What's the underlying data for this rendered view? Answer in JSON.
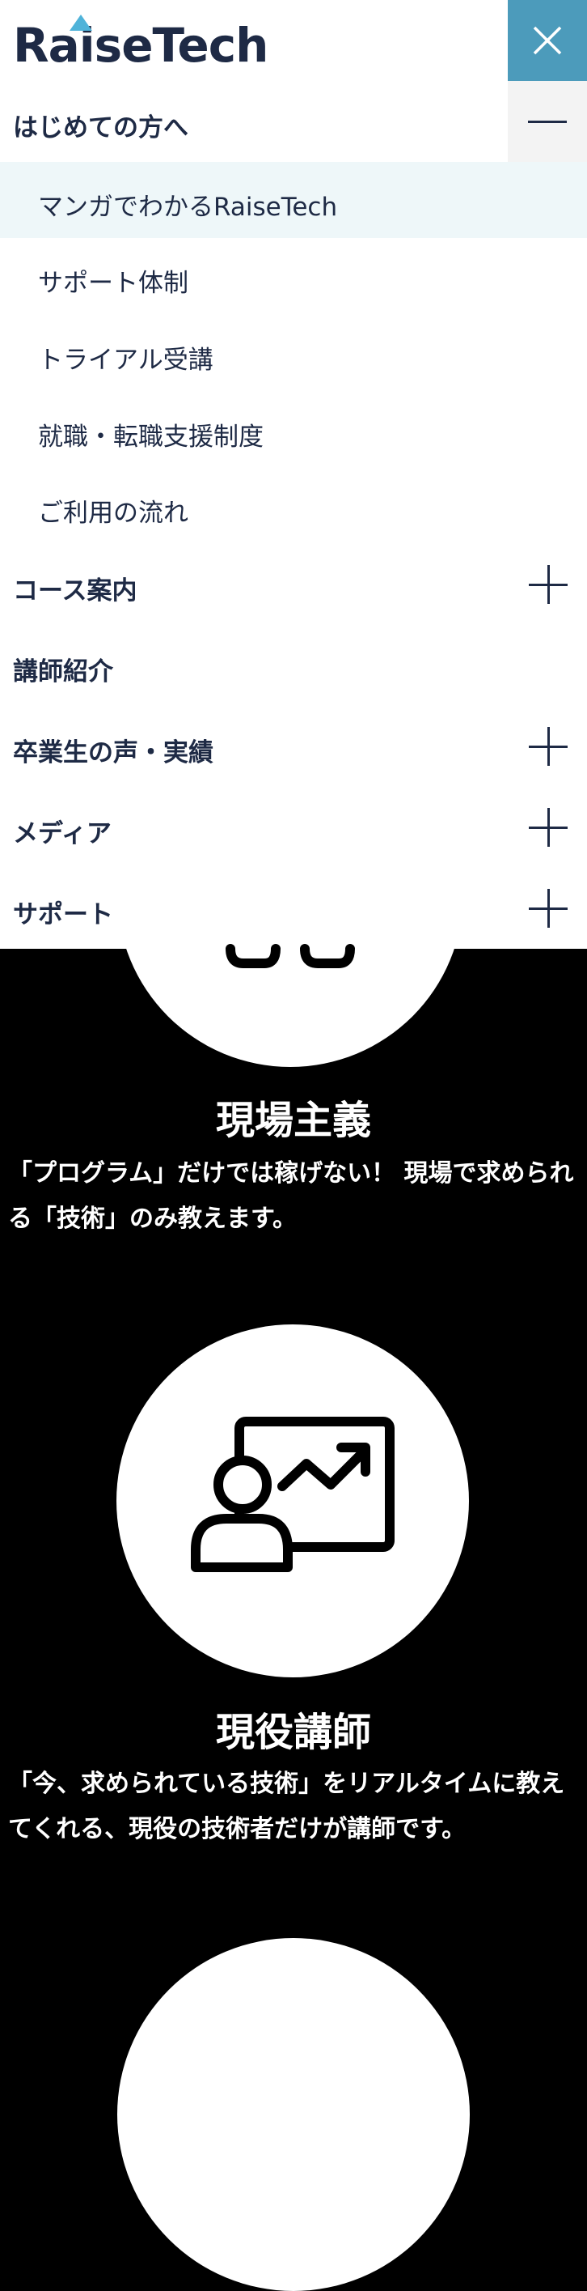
{
  "header": {
    "logo_text": "RaiseTech",
    "brand_color": "#1e2a45",
    "accent_color": "#4fb3d9",
    "close_icon": "close-icon"
  },
  "menu": {
    "section_beginner": "はじめての方へ",
    "beginner_items": [
      "マンガでわかるRaiseTech",
      "サポート体制",
      "トライアル受講",
      "就職・転職支援制度",
      "ご利用の流れ"
    ],
    "course": "コース案内",
    "instructors": "講師紹介",
    "graduates": "卒業生の声・実績",
    "media": "メディア",
    "support": "サポート"
  },
  "features": [
    {
      "title": "現場主義",
      "desc": "「プログラム」だけでは稼げない！ 現場で求められる「技術」のみ教えます。",
      "icon": "handshake-icon"
    },
    {
      "title": "現役講師",
      "desc": "「今、求められている技術」をリアルタイムに教えてくれる、現役の技術者だけが講師です。",
      "icon": "presenter-chart-icon"
    }
  ]
}
